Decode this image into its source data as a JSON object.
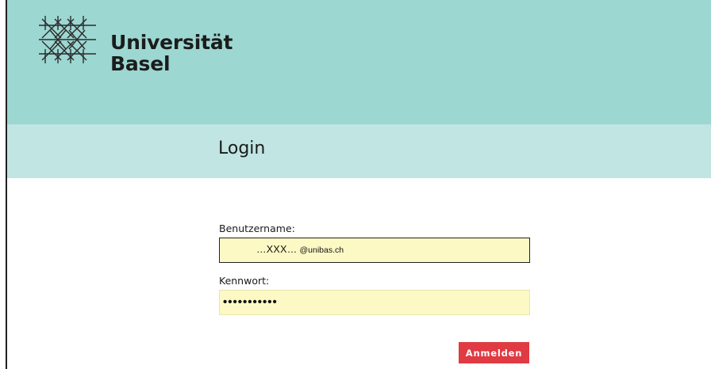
{
  "brand": {
    "line1": "Universität",
    "line2": "Basel",
    "logo_icon": "unibas-lattice-icon"
  },
  "page": {
    "title": "Login"
  },
  "form": {
    "username_label": "Benutzername:",
    "username_value_main": "…XXX…",
    "username_value_domain": "@unibas.ch",
    "password_label": "Kennwort:",
    "password_mask": "•••••••••••",
    "submit_label": "Anmelden"
  },
  "colors": {
    "header": "#9dd7d2",
    "subheader": "#c0e5e2",
    "field": "#fdf9c5",
    "button": "#e03a43"
  }
}
